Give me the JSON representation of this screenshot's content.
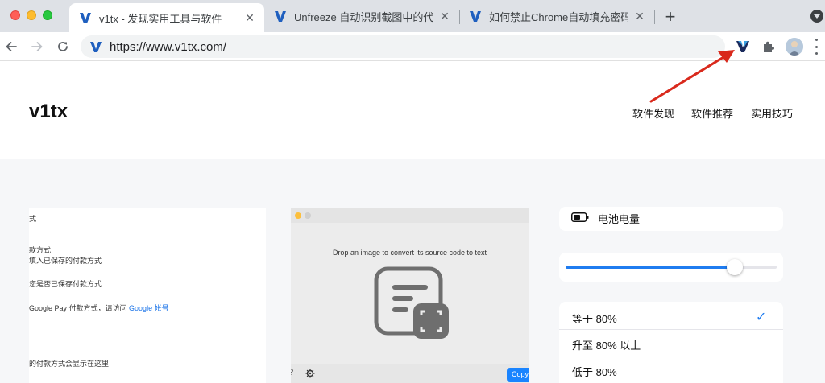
{
  "browser": {
    "tabs": [
      {
        "title": "v1tx - 发现实用工具与软件",
        "favicon": "v1tx-logo-icon",
        "active": true
      },
      {
        "title": "Unfreeze 自动识别截图中的代码",
        "favicon": "v1tx-logo-icon",
        "active": false
      },
      {
        "title": "如何禁止Chrome自动填充密码、",
        "favicon": "v1tx-logo-icon",
        "active": false
      }
    ],
    "tab_close_glyph": "✕",
    "new_tab_glyph": "+",
    "address": "https://www.v1tx.com/",
    "accent_color": "#1f5fbf"
  },
  "site": {
    "logo": "v1tx",
    "nav": [
      "软件发现",
      "软件推荐",
      "实用技巧"
    ]
  },
  "card1": {
    "lines": [
      "式",
      "款方式",
      "填入已保存的付款方式",
      "您是否已保存付款方式",
      "的付款方式会显示在这里"
    ],
    "google_pay_prefix": "Google Pay 付款方式，请访问 ",
    "google_pay_link": "Google 帐号"
  },
  "card2": {
    "drop_text": "Drop an image to convert its source code to text",
    "help_glyph": "?",
    "copy_label": "Copy"
  },
  "card3": {
    "battery_label": "电池电量",
    "slider_level": 0.8,
    "options": [
      {
        "label": "等于 80%",
        "checked": true
      },
      {
        "label": "升至 80% 以上",
        "checked": false
      },
      {
        "label": "低于 80%",
        "checked": false
      }
    ],
    "check_glyph": "✓"
  },
  "annotation": {
    "arrow_color": "#d9291c"
  }
}
